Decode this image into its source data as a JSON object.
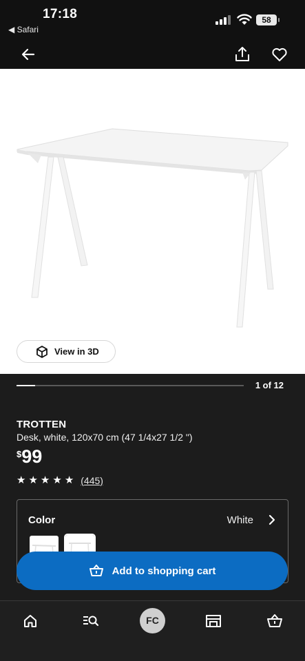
{
  "status_bar": {
    "time": "17:18",
    "back_app": "◀ Safari",
    "battery": "58"
  },
  "header": {
    "back_icon": "arrow-left-icon",
    "share_icon": "share-icon",
    "favorite_icon": "heart-icon"
  },
  "gallery": {
    "view_3d_label": "View in 3D",
    "pager": "1 of 12",
    "progress": 0.0833
  },
  "product": {
    "name": "TROTTEN",
    "description": "Desk, white, 120x70 cm (47 1/4x27 1/2 \")",
    "price_currency": "$",
    "price_amount": "99",
    "rating_stars": 5,
    "review_count": "(445)"
  },
  "color_selector": {
    "label": "Color",
    "value": "White"
  },
  "cart_button": {
    "label": "Add to shopping cart"
  },
  "tabbar": {
    "avatar_initials": "FC",
    "items": [
      "home-icon",
      "search-icon",
      "profile-avatar",
      "store-icon",
      "basket-icon"
    ]
  },
  "colors": {
    "background": "#1c1c1c",
    "header": "#111111",
    "accent_blue": "#0c6cc2"
  }
}
